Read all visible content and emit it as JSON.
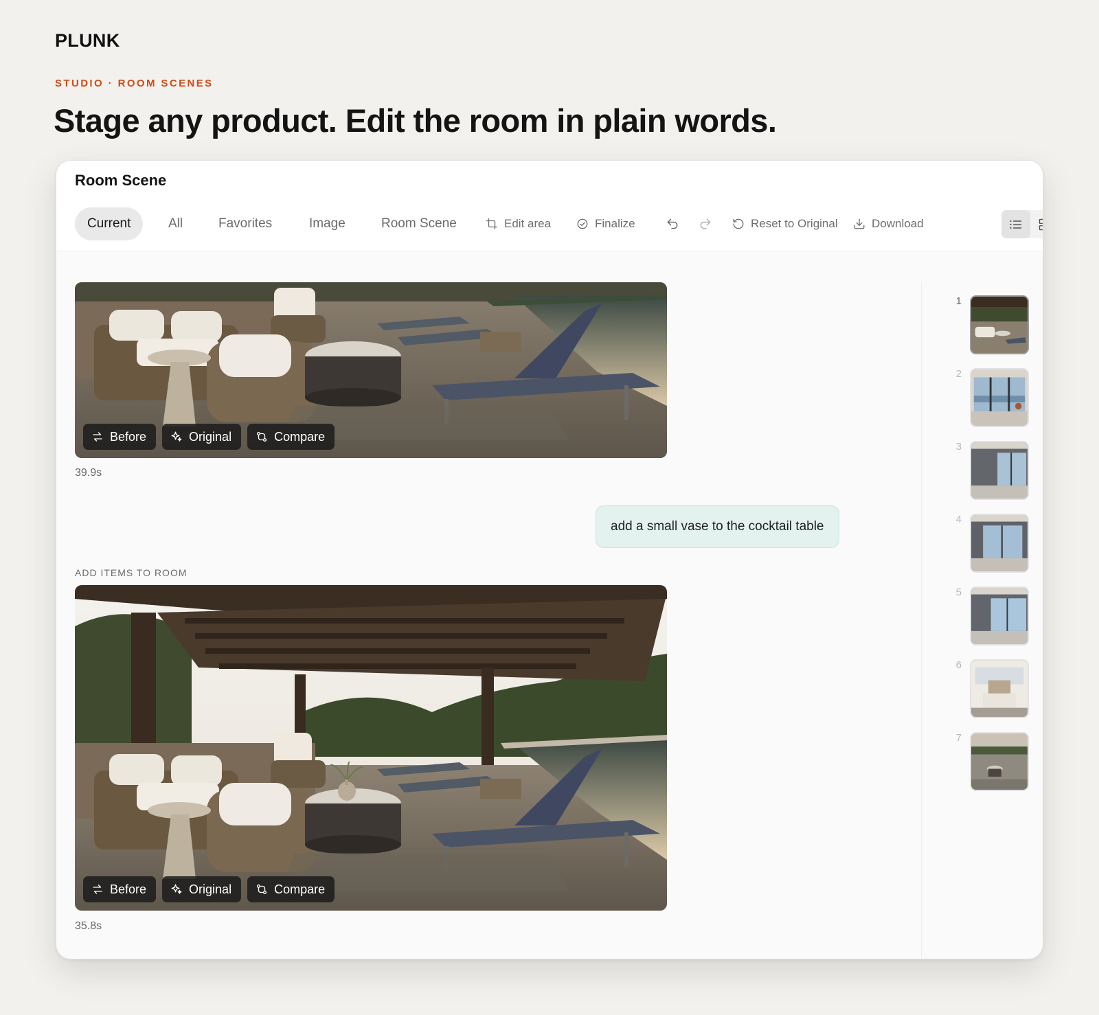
{
  "brand": "PLUNK",
  "eyebrow": "STUDIO · ROOM SCENES",
  "headline": "Stage any product. Edit the room in plain words.",
  "panel": {
    "title": "Room Scene",
    "tabs": [
      "Current",
      "All",
      "Favorites",
      "Image",
      "Room Scene"
    ],
    "actions": {
      "edit_area": "Edit area",
      "finalize": "Finalize",
      "reset": "Reset to Original",
      "download": "Download"
    },
    "icons": {
      "edit_area": "crop-icon",
      "finalize": "check-circle-icon",
      "undo": "undo-icon",
      "redo": "redo-icon",
      "reset": "reset-icon",
      "download": "download-icon",
      "list_view": "list-view-icon",
      "grid_view": "grid-view-icon"
    },
    "active_tab": "Current",
    "active_view": "list"
  },
  "results": [
    {
      "time": "39.9s",
      "overlay": [
        "Before",
        "Original",
        "Compare"
      ]
    },
    {
      "label": "ADD ITEMS TO ROOM",
      "time": "35.8s",
      "overlay": [
        "Before",
        "Original",
        "Compare"
      ]
    }
  ],
  "prompt": "add a small vase to the cocktail table",
  "thumbnails": [
    "1",
    "2",
    "3",
    "4",
    "5",
    "6",
    "7"
  ],
  "active_thumbnail": "1",
  "colors": {
    "accent": "#d14a12",
    "bubble": "#e3f2ef",
    "background": "#f3f1ee"
  }
}
